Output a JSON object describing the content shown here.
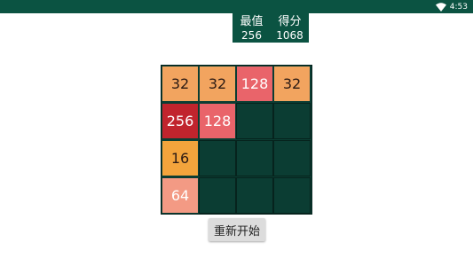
{
  "status_bar": {
    "time": "4:53",
    "wifi_icon": "wifi-icon"
  },
  "score": {
    "best_label": "最值",
    "best_value": "256",
    "score_label": "得分",
    "score_value": "1068"
  },
  "board": {
    "size": 4,
    "tiles": [
      {
        "row": 0,
        "col": 0,
        "value": "32",
        "color": "#f2a45f",
        "text": "dark"
      },
      {
        "row": 0,
        "col": 1,
        "value": "32",
        "color": "#f2a45f",
        "text": "dark"
      },
      {
        "row": 0,
        "col": 2,
        "value": "128",
        "color": "#e9646a",
        "text": "light"
      },
      {
        "row": 0,
        "col": 3,
        "value": "32",
        "color": "#f2a45f",
        "text": "dark"
      },
      {
        "row": 1,
        "col": 0,
        "value": "256",
        "color": "#c1242d",
        "text": "light"
      },
      {
        "row": 1,
        "col": 1,
        "value": "128",
        "color": "#e9646a",
        "text": "light"
      },
      {
        "row": 2,
        "col": 0,
        "value": "16",
        "color": "#f3a43c",
        "text": "dark"
      },
      {
        "row": 3,
        "col": 0,
        "value": "64",
        "color": "#f39a84",
        "text": "light"
      }
    ],
    "empty_color": "#0b3d33"
  },
  "controls": {
    "restart_label": "重新开始"
  }
}
